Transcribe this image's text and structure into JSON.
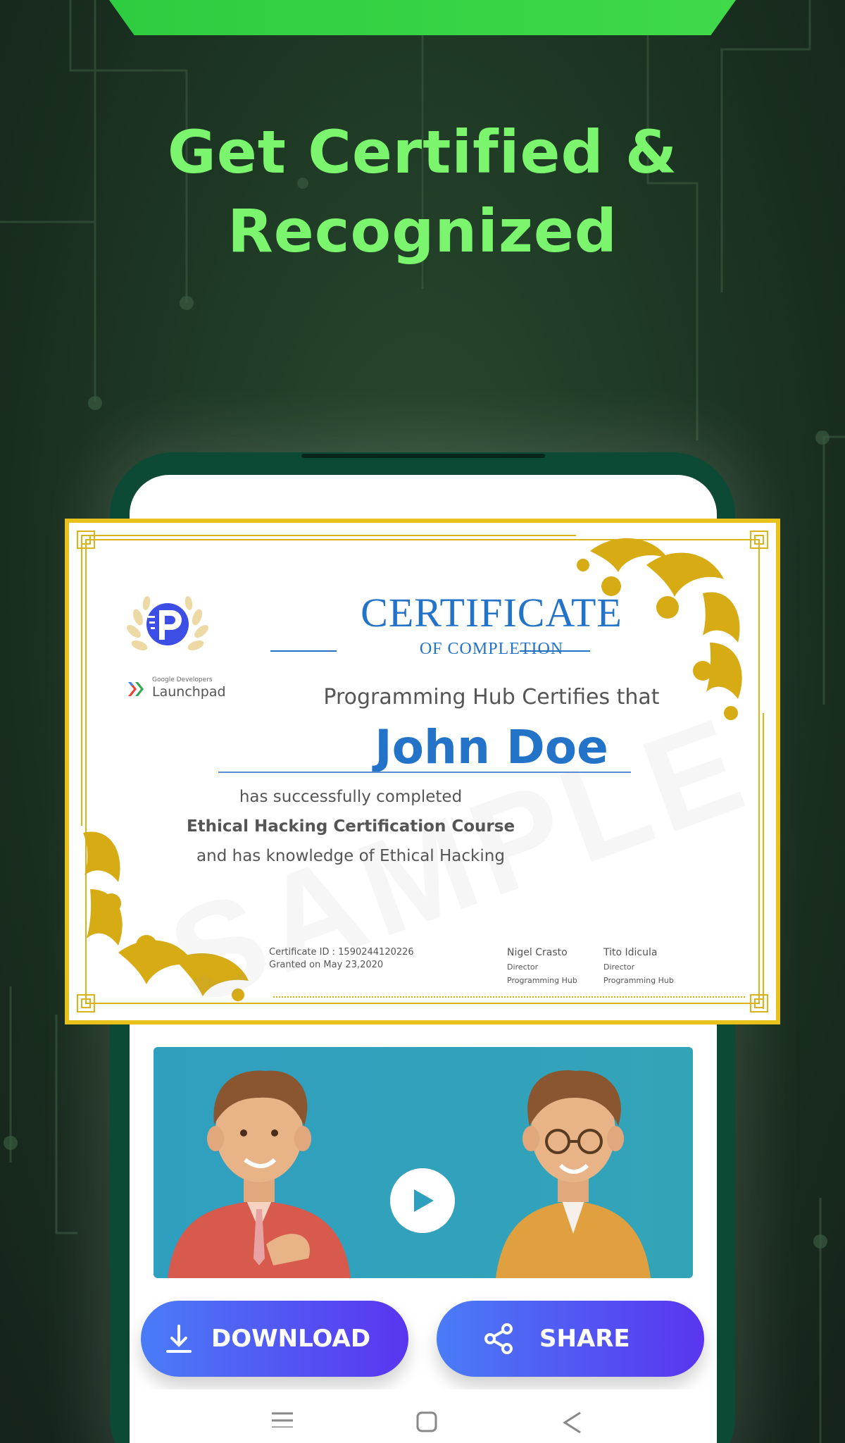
{
  "headline": {
    "line1": "Get Certified &",
    "line2": "Recognized"
  },
  "certificate": {
    "title": "CERTIFICATE",
    "subtitle": "OF COMPLETION",
    "issuer_text": "Programming Hub Certifies that",
    "recipient_name": "John Doe",
    "line1": "has successfully completed",
    "course": "Ethical Hacking Certification Course",
    "line3": "and has knowledge of Ethical Hacking",
    "certificate_id": "Certificate ID : 1590244120226",
    "granted": "Granted on May 23,2020",
    "watermark": "SAMPLE",
    "partner_small": "Google Developers",
    "partner_big": "Launchpad",
    "signatories": [
      {
        "name": "Nigel Crasto",
        "role": "Director",
        "org": "Programming Hub"
      },
      {
        "name": "Tito Idicula",
        "role": "Director",
        "org": "Programming Hub"
      }
    ]
  },
  "video": {
    "play_icon": "play-icon"
  },
  "actions": {
    "download_label": "DOWNLOAD",
    "download_icon": "download-icon",
    "share_label": "SHARE",
    "share_icon": "share-icon"
  },
  "nav": {
    "icons": [
      "menu-icon",
      "home-icon",
      "back-icon"
    ]
  },
  "colors": {
    "headline": "#7cf56e",
    "accent_green": "#2ecc40",
    "cert_blue": "#2373c9",
    "gold": "#e8c21b",
    "button_start": "#4a7cf6",
    "button_end": "#5a35f0"
  }
}
